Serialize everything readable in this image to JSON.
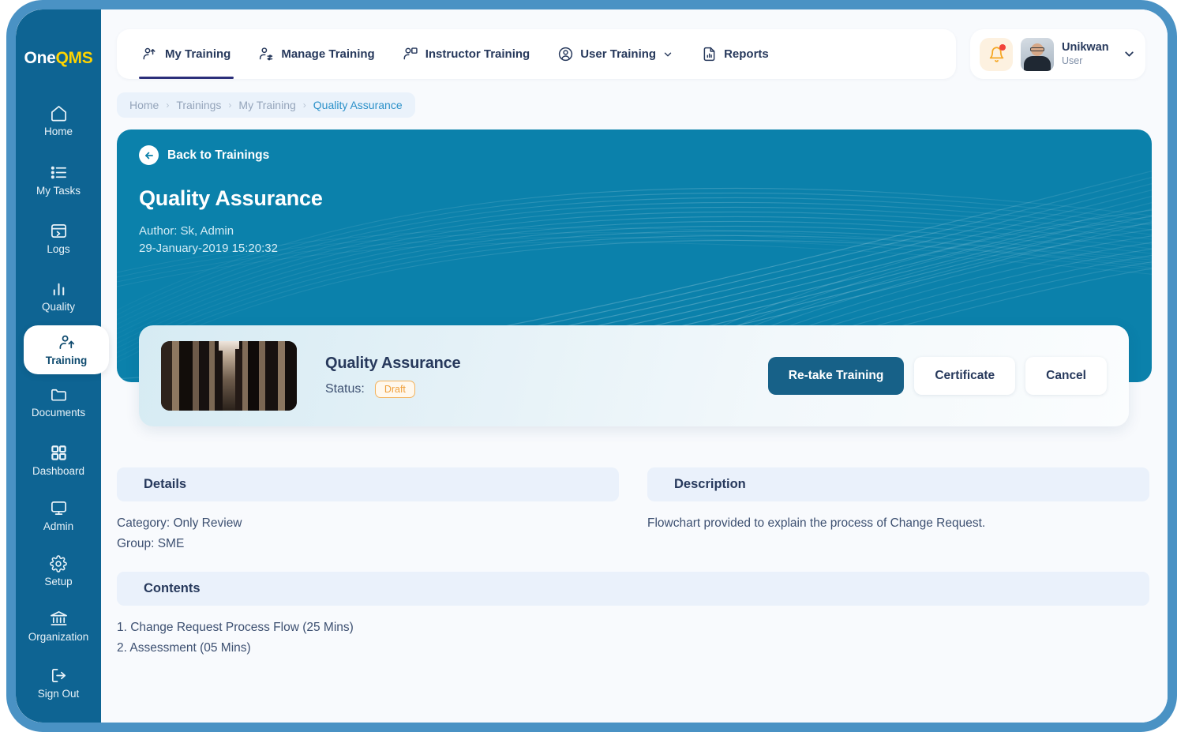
{
  "brand": {
    "part1": "One",
    "part2": "QMS"
  },
  "sidebar": {
    "items": [
      {
        "label": "Home",
        "icon": "home-icon",
        "active": false
      },
      {
        "label": "My Tasks",
        "icon": "list-icon",
        "active": false
      },
      {
        "label": "Logs",
        "icon": "logs-icon",
        "active": false
      },
      {
        "label": "Quality",
        "icon": "bar-chart-icon",
        "active": false
      },
      {
        "label": "Training",
        "icon": "user-add-icon",
        "active": true
      },
      {
        "label": "Documents",
        "icon": "folder-icon",
        "active": false
      },
      {
        "label": "Dashboard",
        "icon": "grid-icon",
        "active": false
      },
      {
        "label": "Admin",
        "icon": "monitor-icon",
        "active": false
      },
      {
        "label": "Setup",
        "icon": "gear-icon",
        "active": false
      },
      {
        "label": "Organization",
        "icon": "bank-icon",
        "active": false
      },
      {
        "label": "Sign Out",
        "icon": "sign-out-icon",
        "active": false
      }
    ]
  },
  "topnav": {
    "tabs": [
      {
        "label": "My Training",
        "icon": "user-up-icon",
        "active": true,
        "caret": false
      },
      {
        "label": "Manage Training",
        "icon": "user-settings-icon",
        "active": false,
        "caret": false
      },
      {
        "label": "Instructor Training",
        "icon": "user-badge-icon",
        "active": false,
        "caret": false
      },
      {
        "label": "User Training",
        "icon": "user-circle-icon",
        "active": false,
        "caret": true
      },
      {
        "label": "Reports",
        "icon": "report-icon",
        "active": false,
        "caret": false
      }
    ]
  },
  "profile": {
    "notification_icon": "bell-icon",
    "has_notification": true,
    "name": "Unikwan",
    "role": "User",
    "caret_icon": "chevron-down-icon"
  },
  "breadcrumb": {
    "items": [
      "Home",
      "Trainings",
      "My Training",
      "Quality Assurance"
    ],
    "separator": "›",
    "current_index": 3
  },
  "hero": {
    "back_label": "Back to Trainings",
    "back_icon": "arrow-left-icon",
    "title": "Quality Assurance",
    "author": "Author: Sk, Admin",
    "datetime": "29-January-2019  15:20:32"
  },
  "course_card": {
    "thumbnail_alt": "corridor-photo",
    "title": "Quality Assurance",
    "status_label": "Status:",
    "status_value": "Draft",
    "actions": [
      {
        "label": "Re-take Training",
        "style": "primary"
      },
      {
        "label": "Certificate",
        "style": "ghost"
      },
      {
        "label": "Cancel",
        "style": "ghost"
      }
    ]
  },
  "details": {
    "heading": "Details",
    "category": "Category: Only Review",
    "group": "Group: SME"
  },
  "description": {
    "heading": "Description",
    "text": "Flowchart provided to explain the process of Change Request."
  },
  "contents": {
    "heading": "Contents",
    "items": [
      "1. Change Request Process Flow  (25 Mins)",
      "2. Assessment  (05 Mins)"
    ]
  },
  "colors": {
    "sidebar_bg": "#0e6493",
    "hero_bg": "#0b81ab",
    "frame_border": "#4a92c4",
    "accent_yellow": "#ffd400",
    "status_orange": "#f0a03c",
    "primary_button": "#176188",
    "breadcrumb_current": "#2c91c9"
  }
}
